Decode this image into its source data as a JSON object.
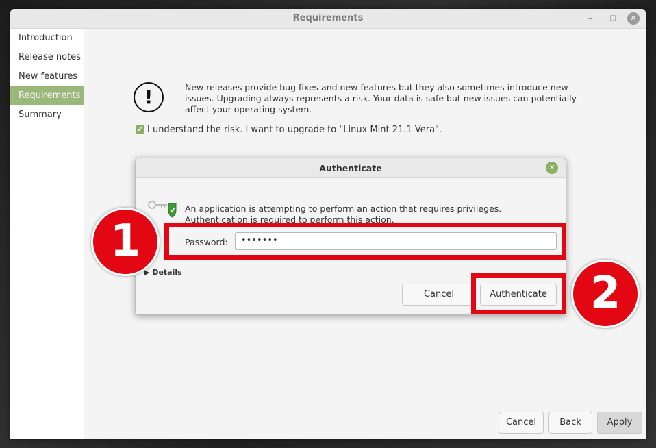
{
  "window": {
    "title": "Requirements"
  },
  "sidebar": {
    "items": [
      {
        "label": "Introduction"
      },
      {
        "label": "Release notes"
      },
      {
        "label": "New features"
      },
      {
        "label": "Requirements",
        "active": true
      },
      {
        "label": "Summary"
      }
    ]
  },
  "main": {
    "warning_text": "New releases provide bug fixes and new features but they also sometimes introduce new issues. Upgrading always represents a risk. Your data is safe but new issues can potentially affect your operating system.",
    "checkbox_label": "I understand the risk. I want to upgrade to \"Linux Mint 21.1 Vera\".",
    "checkbox_checked": true
  },
  "footer": {
    "cancel_label": "Cancel",
    "back_label": "Back",
    "apply_label": "Apply"
  },
  "dialog": {
    "title": "Authenticate",
    "message": "An application is attempting to perform an action that requires privileges. Authentication is required to perform this action.",
    "password_label": "Password:",
    "password_value": "•••••••",
    "details_label": "Details",
    "cancel_label": "Cancel",
    "authenticate_label": "Authenticate"
  },
  "annotations": {
    "step1": "1",
    "step2": "2",
    "highlight_color": "#e30613"
  },
  "colors": {
    "accent": "#8ab065",
    "sidebar_active": "#9ab87a"
  }
}
